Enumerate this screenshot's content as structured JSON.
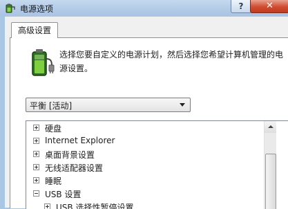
{
  "window": {
    "title": "电源选项",
    "help_label": "?",
    "close_label": "✕"
  },
  "tabs": [
    {
      "label": "高级设置",
      "selected": true
    }
  ],
  "description": "选择您要自定义的电源计划，然后选择您希望计算机管理的电源设置。",
  "plan_select": {
    "value": "平衡 [活动]"
  },
  "tree": {
    "items": [
      {
        "label": "硬盘",
        "expander": "plus"
      },
      {
        "label": "Internet Explorer",
        "expander": "plus"
      },
      {
        "label": "桌面背景设置",
        "expander": "plus"
      },
      {
        "label": "无线适配器设置",
        "expander": "plus"
      },
      {
        "label": "睡眠",
        "expander": "plus"
      },
      {
        "label": "USB 设置",
        "expander": "minus"
      },
      {
        "label": "USB 选择性暂停设置",
        "expander": "plus"
      }
    ]
  },
  "colors": {
    "close_button": "#c8432a",
    "titlebar": "#b3cbe7",
    "panel": "#ffffff"
  }
}
